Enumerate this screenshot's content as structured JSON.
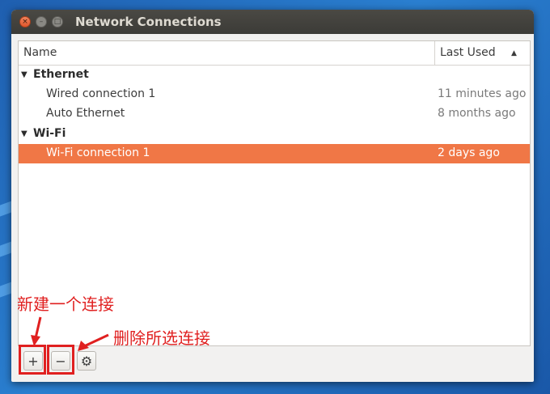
{
  "window": {
    "title": "Network Connections"
  },
  "titlebar_buttons": {
    "close": "×",
    "minimize": "–",
    "maximize": "□"
  },
  "columns": {
    "name": "Name",
    "last_used": "Last Used",
    "sort_indicator": "▲"
  },
  "groups": [
    {
      "label": "Ethernet",
      "expander": "▼",
      "items": [
        {
          "name": "Wired connection 1",
          "last_used": "11 minutes ago"
        },
        {
          "name": "Auto Ethernet",
          "last_used": "8 months ago"
        }
      ]
    },
    {
      "label": "Wi-Fi",
      "expander": "▼",
      "items": [
        {
          "name": "Wi-Fi connection 1",
          "last_used": "2 days ago",
          "selected": true
        }
      ]
    }
  ],
  "toolbar": {
    "add": "+",
    "remove": "−",
    "settings": "⚙"
  },
  "annotations": {
    "add_note": "新建一个连接",
    "remove_note": "删除所选连接",
    "color": "#e02020"
  },
  "colors": {
    "selection": "#f07746",
    "titlebar": "#3c3b37",
    "accent_close": "#e2562b"
  }
}
